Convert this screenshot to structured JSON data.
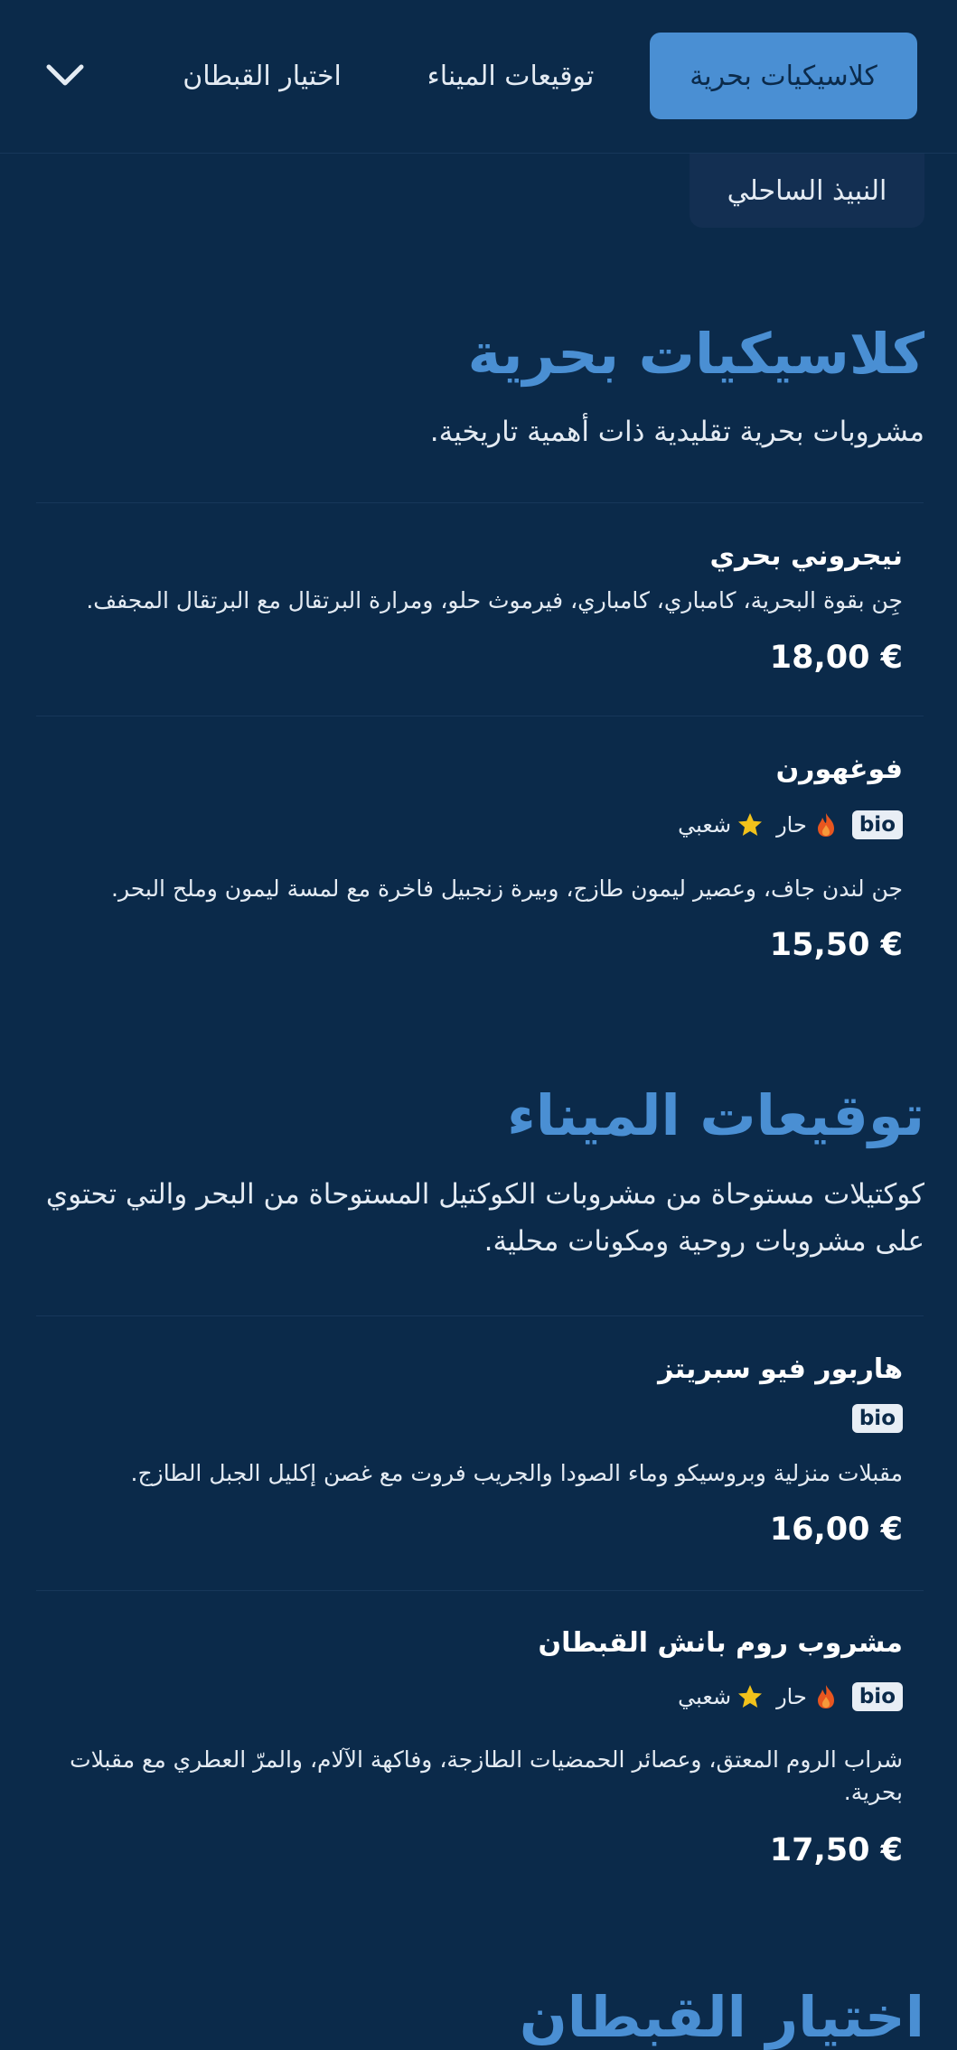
{
  "nav": {
    "tabs": [
      {
        "label": "كلاسيكيات بحرية",
        "active": true
      },
      {
        "label": "توقيعات الميناء",
        "active": false
      },
      {
        "label": "اختيار القبطان",
        "active": false
      }
    ],
    "expand_icon": "chevron-down-icon",
    "chip_label": "النبيذ الساحلي"
  },
  "sections": [
    {
      "title": "كلاسيكيات بحرية",
      "description": "مشروبات بحرية تقليدية ذات أهمية تاريخية.",
      "items": [
        {
          "name": "نيجروني بحري",
          "description": "جِن بقوة البحرية، كامباري، كامباري، فيرموث حلو، ومرارة البرتقال مع البرتقال المجفف.",
          "price": "18,00 €"
        },
        {
          "name": "فوغهورن",
          "badges": {
            "bio": "bio",
            "hot": "حار",
            "popular": "شعبي"
          },
          "description": "جن لندن جاف، وعصير ليمون طازج، وبيرة زنجبيل فاخرة مع لمسة ليمون وملح البحر.",
          "price": "15,50 €"
        }
      ]
    },
    {
      "title": "توقيعات الميناء",
      "description": "كوكتيلات مستوحاة من مشروبات الكوكتيل المستوحاة من البحر والتي تحتوي على مشروبات روحية ومكونات محلية.",
      "items": [
        {
          "name": "هاربور فيو سبريتز",
          "badges": {
            "bio": "bio"
          },
          "description": "مقبلات منزلية وبروسيكو وماء الصودا والجريب فروت مع غصن إكليل الجبل الطازج.",
          "price": "16,00 €"
        },
        {
          "name": "مشروب روم بانش القبطان",
          "badges": {
            "bio": "bio",
            "hot": "حار",
            "popular": "شعبي"
          },
          "description": "شراب الروم المعتق، وعصائر الحمضيات الطازجة، وفاكهة الآلام، والمرّ العطري مع مقبلات بحرية.",
          "price": "17,50 €"
        }
      ]
    },
    {
      "title": "اختيار القبطان"
    }
  ],
  "colors": {
    "background": "#0b2a4a",
    "accent": "#4a8fd3",
    "hot_icon": "#e8561f",
    "star_icon": "#f2c21b"
  }
}
